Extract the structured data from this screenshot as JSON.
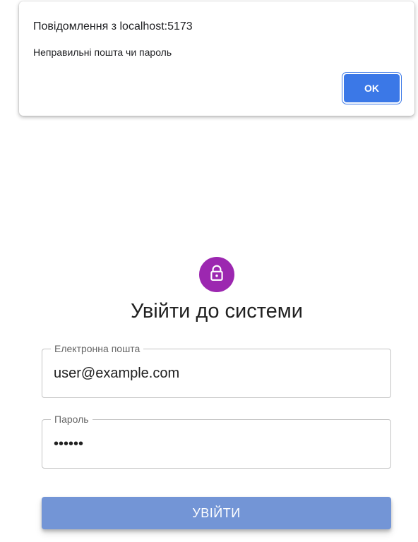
{
  "alert": {
    "title": "Повідомлення з localhost:5173",
    "message": "Неправильні пошта чи пароль",
    "ok_label": "OK"
  },
  "login": {
    "icon": "lock-icon",
    "title": "Увійти до системи",
    "email": {
      "label": "Електронна пошта",
      "value": "user@example.com"
    },
    "password": {
      "label": "Пароль",
      "value": "••••••"
    },
    "submit_label": "УВІЙТИ"
  },
  "colors": {
    "avatar": "#9c27b0",
    "ok_button": "#3b78e7",
    "submit_button": "#7395d6",
    "field_border": "#c4c4c4"
  }
}
